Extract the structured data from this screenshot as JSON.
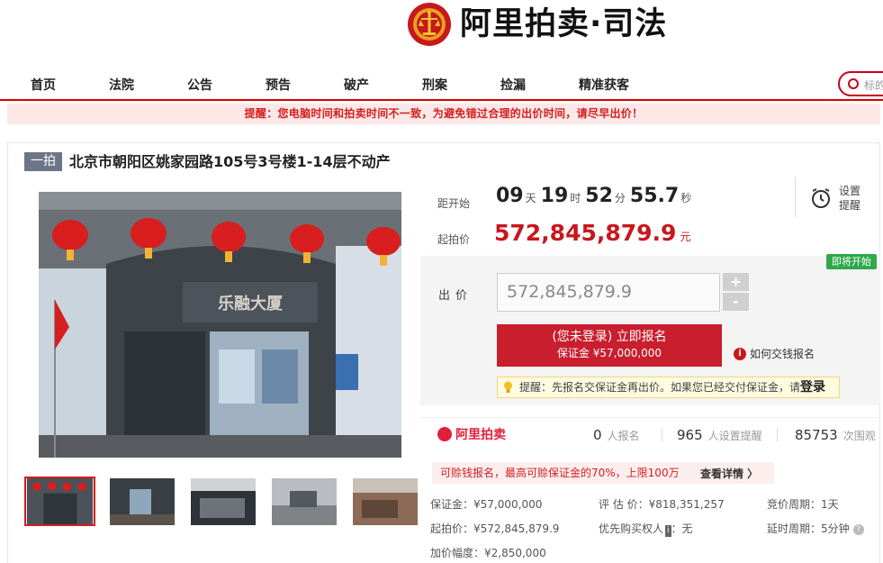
{
  "header": {
    "logo_text": "阿里拍卖·司法"
  },
  "nav": {
    "items": [
      "首页",
      "法院",
      "公告",
      "预告",
      "破产",
      "刑案",
      "捡漏",
      "精准获客"
    ],
    "search_placeholder": "标的"
  },
  "notice": "提醒：您电脑时间和拍卖时间不一致，为避免错过合理的出价时间，请尽早出价！",
  "lot": {
    "tag": "一拍",
    "title": "北京市朝阳区姚家园路105号3号楼1-14层不动产",
    "photo_sign": "乐融大厦"
  },
  "countdown": {
    "label": "距开始",
    "days": "09",
    "days_unit": "天",
    "hours": "19",
    "hours_unit": "时",
    "minutes": "52",
    "minutes_unit": "分",
    "seconds": "55.7",
    "seconds_unit": "秒"
  },
  "start_price": {
    "label": "起拍价",
    "value": "572,845,879.9",
    "unit": "元"
  },
  "reminder": {
    "line1": "设置",
    "line2": "提醒"
  },
  "bid": {
    "status_badge": "即将开始",
    "label": "出价",
    "value": "572,845,879.9",
    "plus": "+",
    "minus": "-",
    "apply_line1": "(您未登录) 立即报名",
    "apply_line2": "保证金 ¥57,000,000",
    "help_link": "如何交钱报名",
    "tip_text": "提醒：先报名交保证金再出价。如果您已经交付保证金，请",
    "tip_link": "登录"
  },
  "stats": {
    "brand": "阿里拍卖",
    "signups": "0",
    "signups_unit": "人报名",
    "reminders": "965",
    "reminders_unit": "人设置提醒",
    "views": "85753",
    "views_unit": "次围观"
  },
  "promo": {
    "text": "可赊钱报名，最高可赊保证金的70%，上限100万",
    "link": "查看详情 〉"
  },
  "details": {
    "deposit": "保证金：¥57,000,000",
    "appraisal": "评 估 价：¥818,351,257",
    "period": "竞价周期：1天",
    "start": "起拍价：¥572,845,879.9",
    "priority_label": "优先购买权人",
    "priority_tag": "i",
    "priority_value": "：无",
    "extension": "延时周期：5分钟",
    "extension_help": "?",
    "increment": "加价幅度：¥2,850,000"
  },
  "colors": {
    "brand_red": "#c8171e",
    "nav_underline": "#d90000",
    "status_green": "#2fa84a"
  }
}
